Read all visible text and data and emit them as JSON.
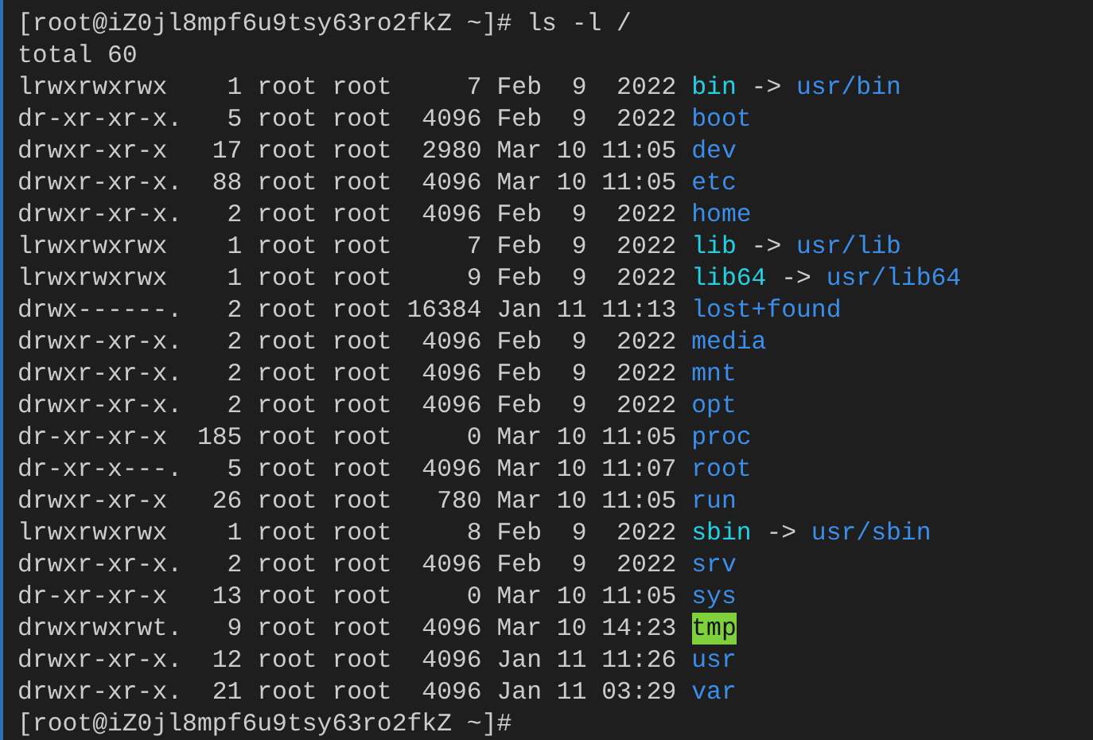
{
  "terminal": {
    "command_prompt": {
      "prompt": "[root@iZ0jl8mpf6u9tsy63ro2fkZ ~]#",
      "command": "ls -l /"
    },
    "total": "total 60",
    "entries": [
      {
        "info": "lrwxrwxrwx    1 root root     7 Feb  9  2022",
        "name": "bin",
        "kind": "symlink",
        "arrow": "->",
        "target": "usr/bin"
      },
      {
        "info": "dr-xr-xr-x.   5 root root  4096 Feb  9  2022",
        "name": "boot",
        "kind": "dir"
      },
      {
        "info": "drwxr-xr-x   17 root root  2980 Mar 10 11:05",
        "name": "dev",
        "kind": "dir"
      },
      {
        "info": "drwxr-xr-x.  88 root root  4096 Mar 10 11:05",
        "name": "etc",
        "kind": "dir"
      },
      {
        "info": "drwxr-xr-x.   2 root root  4096 Feb  9  2022",
        "name": "home",
        "kind": "dir"
      },
      {
        "info": "lrwxrwxrwx    1 root root     7 Feb  9  2022",
        "name": "lib",
        "kind": "symlink",
        "arrow": "->",
        "target": "usr/lib"
      },
      {
        "info": "lrwxrwxrwx    1 root root     9 Feb  9  2022",
        "name": "lib64",
        "kind": "symlink",
        "arrow": "->",
        "target": "usr/lib64"
      },
      {
        "info": "drwx------.   2 root root 16384 Jan 11 11:13",
        "name": "lost+found",
        "kind": "dir"
      },
      {
        "info": "drwxr-xr-x.   2 root root  4096 Feb  9  2022",
        "name": "media",
        "kind": "dir"
      },
      {
        "info": "drwxr-xr-x.   2 root root  4096 Feb  9  2022",
        "name": "mnt",
        "kind": "dir"
      },
      {
        "info": "drwxr-xr-x.   2 root root  4096 Feb  9  2022",
        "name": "opt",
        "kind": "dir"
      },
      {
        "info": "dr-xr-xr-x  185 root root     0 Mar 10 11:05",
        "name": "proc",
        "kind": "dir"
      },
      {
        "info": "dr-xr-x---.   5 root root  4096 Mar 10 11:07",
        "name": "root",
        "kind": "dir"
      },
      {
        "info": "drwxr-xr-x   26 root root   780 Mar 10 11:05",
        "name": "run",
        "kind": "dir"
      },
      {
        "info": "lrwxrwxrwx    1 root root     8 Feb  9  2022",
        "name": "sbin",
        "kind": "symlink",
        "arrow": "->",
        "target": "usr/sbin"
      },
      {
        "info": "drwxr-xr-x.   2 root root  4096 Feb  9  2022",
        "name": "srv",
        "kind": "dir"
      },
      {
        "info": "dr-xr-xr-x   13 root root     0 Mar 10 11:05",
        "name": "sys",
        "kind": "dir"
      },
      {
        "info": "drwxrwxrwt.   9 root root  4096 Mar 10 14:23",
        "name": "tmp",
        "kind": "sticky"
      },
      {
        "info": "drwxr-xr-x.  12 root root  4096 Jan 11 11:26",
        "name": "usr",
        "kind": "dir"
      },
      {
        "info": "drwxr-xr-x.  21 root root  4096 Jan 11 03:29",
        "name": "var",
        "kind": "dir"
      }
    ],
    "final_prompt": "[root@iZ0jl8mpf6u9tsy63ro2fkZ ~]#"
  }
}
